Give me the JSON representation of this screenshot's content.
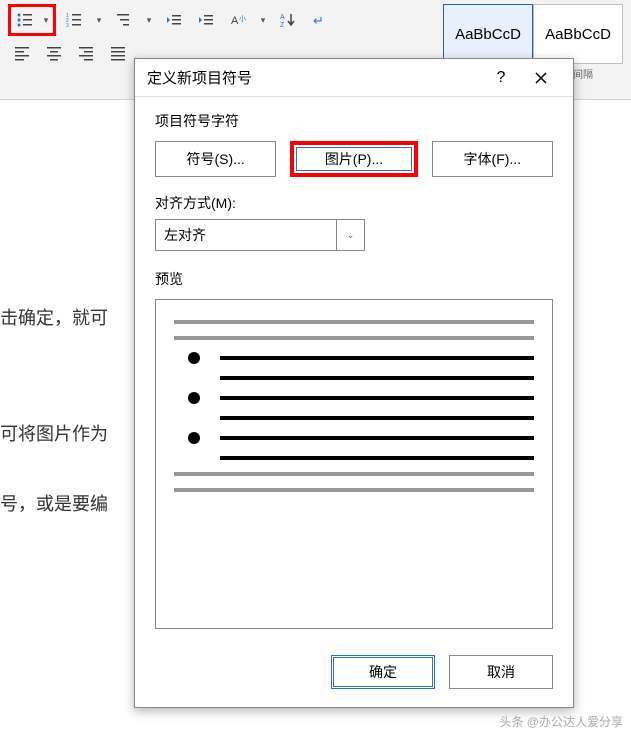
{
  "ribbon": {
    "styles": [
      {
        "sample": "AaBbCcD",
        "name": ""
      },
      {
        "sample": "AaBbCcD",
        "name": ""
      }
    ],
    "style_label_right": "无间隔"
  },
  "bg_lines": [
    "击确定，就可",
    "可将图片作为",
    "号，或是要编"
  ],
  "dialog": {
    "title": "定义新项目符号",
    "help": "?",
    "section_char": "项目符号字符",
    "btn_symbol": "符号(S)...",
    "btn_picture": "图片(P)...",
    "btn_font": "字体(F)...",
    "align_label": "对齐方式(M):",
    "align_value": "左对齐",
    "preview_label": "预览",
    "ok": "确定",
    "cancel": "取消"
  },
  "watermark": "头条 @办公达人爱分享"
}
